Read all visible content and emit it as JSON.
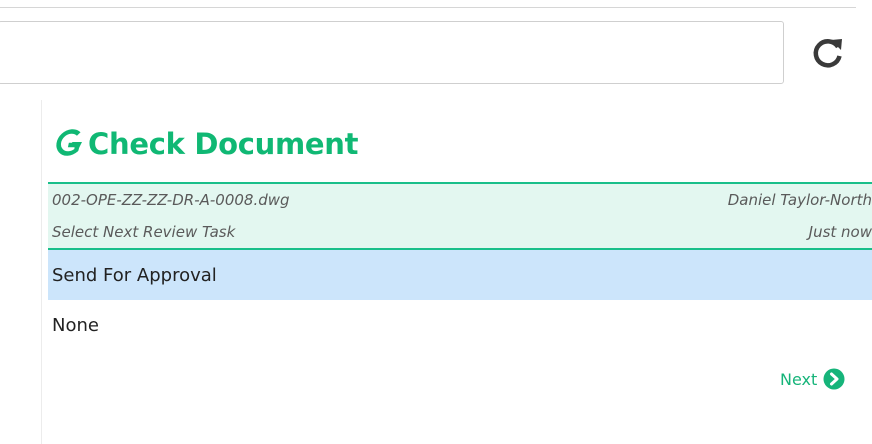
{
  "search": {
    "value": "",
    "placeholder": ""
  },
  "icons": {
    "refresh": "refresh-icon",
    "logo": "g-arrow-logo-icon",
    "next": "chevron-right-circle-icon"
  },
  "colors": {
    "brand_green": "#10b874",
    "meta_background": "#e3f7f0",
    "selected_background": "#cce5fb"
  },
  "panel": {
    "title": "Check Document",
    "document": {
      "filename": "002-OPE-ZZ-ZZ-DR-A-0008.dwg",
      "author": "Daniel Taylor-North",
      "task": "Select Next Review Task",
      "time": "Just now"
    },
    "options": [
      {
        "label": "Send For Approval",
        "selected": true
      },
      {
        "label": "None",
        "selected": false
      }
    ],
    "next_label": "Next"
  }
}
